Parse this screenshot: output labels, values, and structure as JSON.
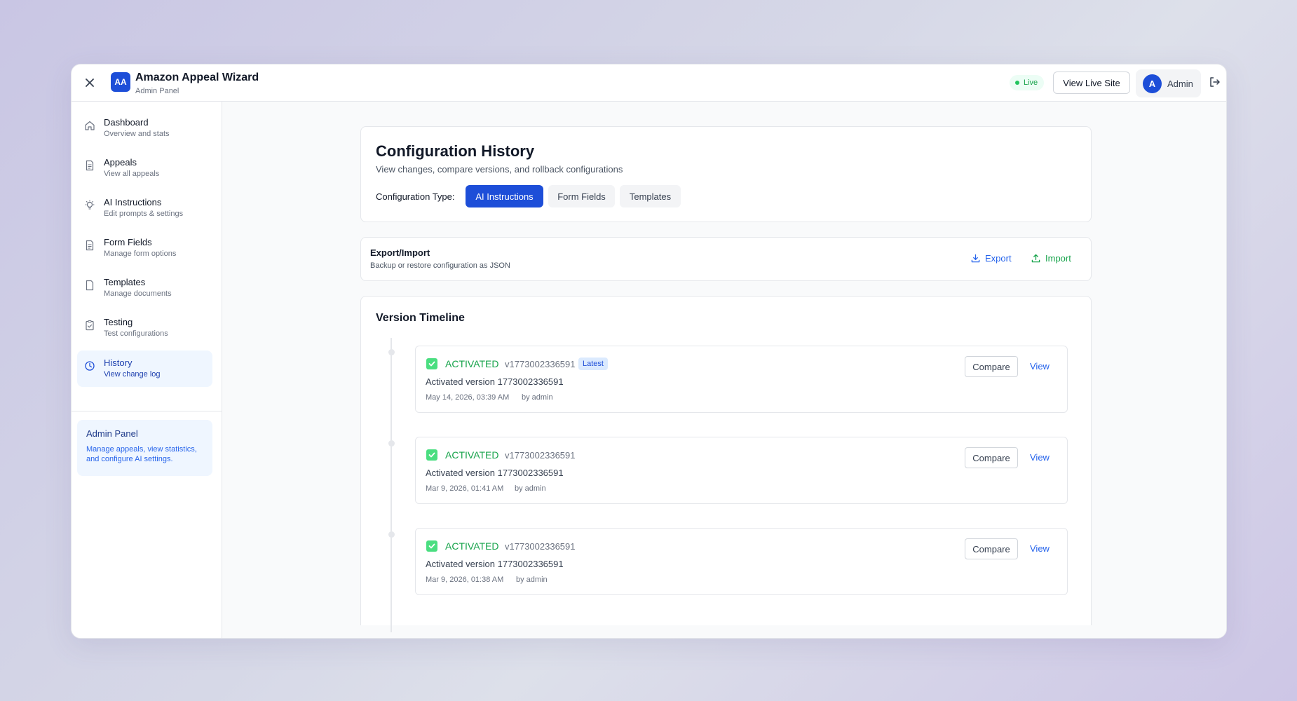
{
  "header": {
    "logo_text": "AA",
    "title": "Amazon Appeal Wizard",
    "subtitle": "Admin Panel",
    "live_label": "Live",
    "view_live_label": "View Live Site",
    "user_initial": "A",
    "user_name": "Admin"
  },
  "sidebar": {
    "items": [
      {
        "label": "Dashboard",
        "sub": "Overview and stats",
        "icon": "home-icon"
      },
      {
        "label": "Appeals",
        "sub": "View all appeals",
        "icon": "document-icon"
      },
      {
        "label": "AI Instructions",
        "sub": "Edit prompts & settings",
        "icon": "lightbulb-icon"
      },
      {
        "label": "Form Fields",
        "sub": "Manage form options",
        "icon": "document-icon"
      },
      {
        "label": "Templates",
        "sub": "Manage documents",
        "icon": "file-icon"
      },
      {
        "label": "Testing",
        "sub": "Test configurations",
        "icon": "clipboard-check-icon"
      },
      {
        "label": "History",
        "sub": "View change log",
        "icon": "clock-icon",
        "active": true
      }
    ],
    "info": {
      "title": "Admin Panel",
      "text": "Manage appeals, view statistics, and configure AI settings."
    }
  },
  "config": {
    "title": "Configuration History",
    "description": "View changes, compare versions, and rollback configurations",
    "type_label": "Configuration Type:",
    "types": [
      "AI Instructions",
      "Form Fields",
      "Templates"
    ],
    "selected_type": "AI Instructions"
  },
  "export": {
    "title": "Export/Import",
    "description": "Backup or restore configuration as JSON",
    "export_label": "Export",
    "import_label": "Import"
  },
  "timeline": {
    "title": "Version Timeline",
    "compare_label": "Compare",
    "view_label": "View",
    "latest_label": "Latest",
    "entries": [
      {
        "status": "ACTIVATED",
        "version": "v1773002336591",
        "description": "Activated version 1773002336591",
        "date": "May 14, 2026, 03:39 AM",
        "by": "by admin",
        "latest": true
      },
      {
        "status": "ACTIVATED",
        "version": "v1773002336591",
        "description": "Activated version 1773002336591",
        "date": "Mar 9, 2026, 01:41 AM",
        "by": "by admin",
        "latest": false
      },
      {
        "status": "ACTIVATED",
        "version": "v1773002336591",
        "description": "Activated version 1773002336591",
        "date": "Mar 9, 2026, 01:38 AM",
        "by": "by admin",
        "latest": false
      }
    ]
  },
  "colors": {
    "primary": "#1d4ed8",
    "success": "#16a34a",
    "live": "#22c55e"
  }
}
